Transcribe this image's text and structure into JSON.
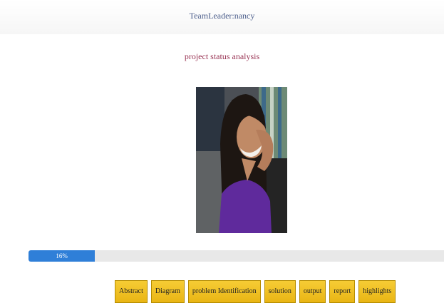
{
  "header": {
    "team_leader": "TeamLeader:nancy"
  },
  "page": {
    "title": "project status analysis"
  },
  "progress": {
    "value": 16,
    "label": "16%"
  },
  "tabs": [
    {
      "label": "Abstract"
    },
    {
      "label": "Diagram"
    },
    {
      "label": "problem Identification"
    },
    {
      "label": "solution"
    },
    {
      "label": "output"
    },
    {
      "label": "report"
    },
    {
      "label": "highlights"
    }
  ],
  "colors": {
    "progress_fill": "#2f7fd8",
    "tab_button": "#f0c020",
    "title_text": "#9a3555",
    "header_text": "#4a5c8a"
  }
}
